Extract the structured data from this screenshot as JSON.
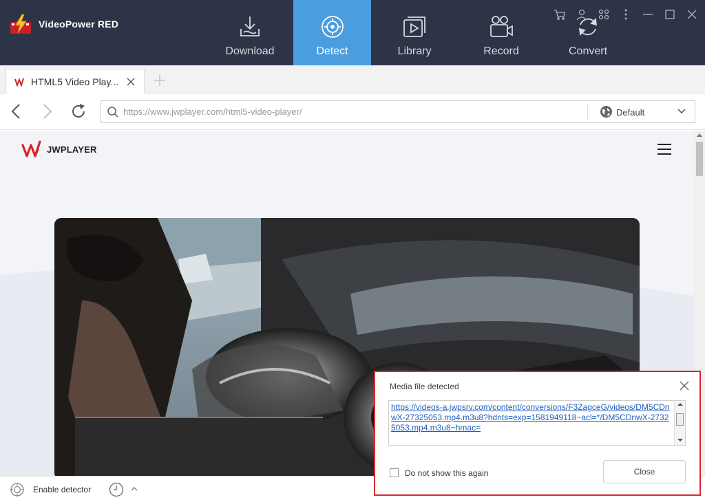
{
  "app": {
    "name": "VideoPower RED"
  },
  "nav": {
    "items": [
      {
        "label": "Download",
        "icon": "download-icon"
      },
      {
        "label": "Detect",
        "icon": "detect-icon",
        "active": true
      },
      {
        "label": "Library",
        "icon": "library-icon"
      },
      {
        "label": "Record",
        "icon": "record-icon"
      },
      {
        "label": "Convert",
        "icon": "convert-icon"
      }
    ]
  },
  "window_controls": [
    "cart-icon",
    "user-icon",
    "apps-icon",
    "more-icon",
    "minimize-icon",
    "maximize-icon",
    "close-icon"
  ],
  "browser": {
    "tab": {
      "title": "HTML5 Video Play..."
    },
    "url": {
      "placeholder": "https://www.jwplayer.com/html5-video-player/"
    },
    "user_agent": {
      "label": "Default"
    }
  },
  "page": {
    "logo_text": "JWPLAYER"
  },
  "bottom": {
    "detector_label": "Enable detector"
  },
  "popup": {
    "title": "Media file detected",
    "link": "https://videos-a.jwpsrv.com/content/conversions/F3ZagceG/videos/DM5CDnwX-27325053.mp4.m3u8?hdnts=exp=1581949118~acl=*/DM5CDnwX-27325053.mp4.m3u8~hmac=",
    "checkbox_label": "Do not show this again",
    "close_label": "Close"
  },
  "colors": {
    "topbar": "#2e3447",
    "active_tab": "#4a9ee0",
    "popup_border": "#d9262b",
    "link": "#1a5fc2"
  }
}
